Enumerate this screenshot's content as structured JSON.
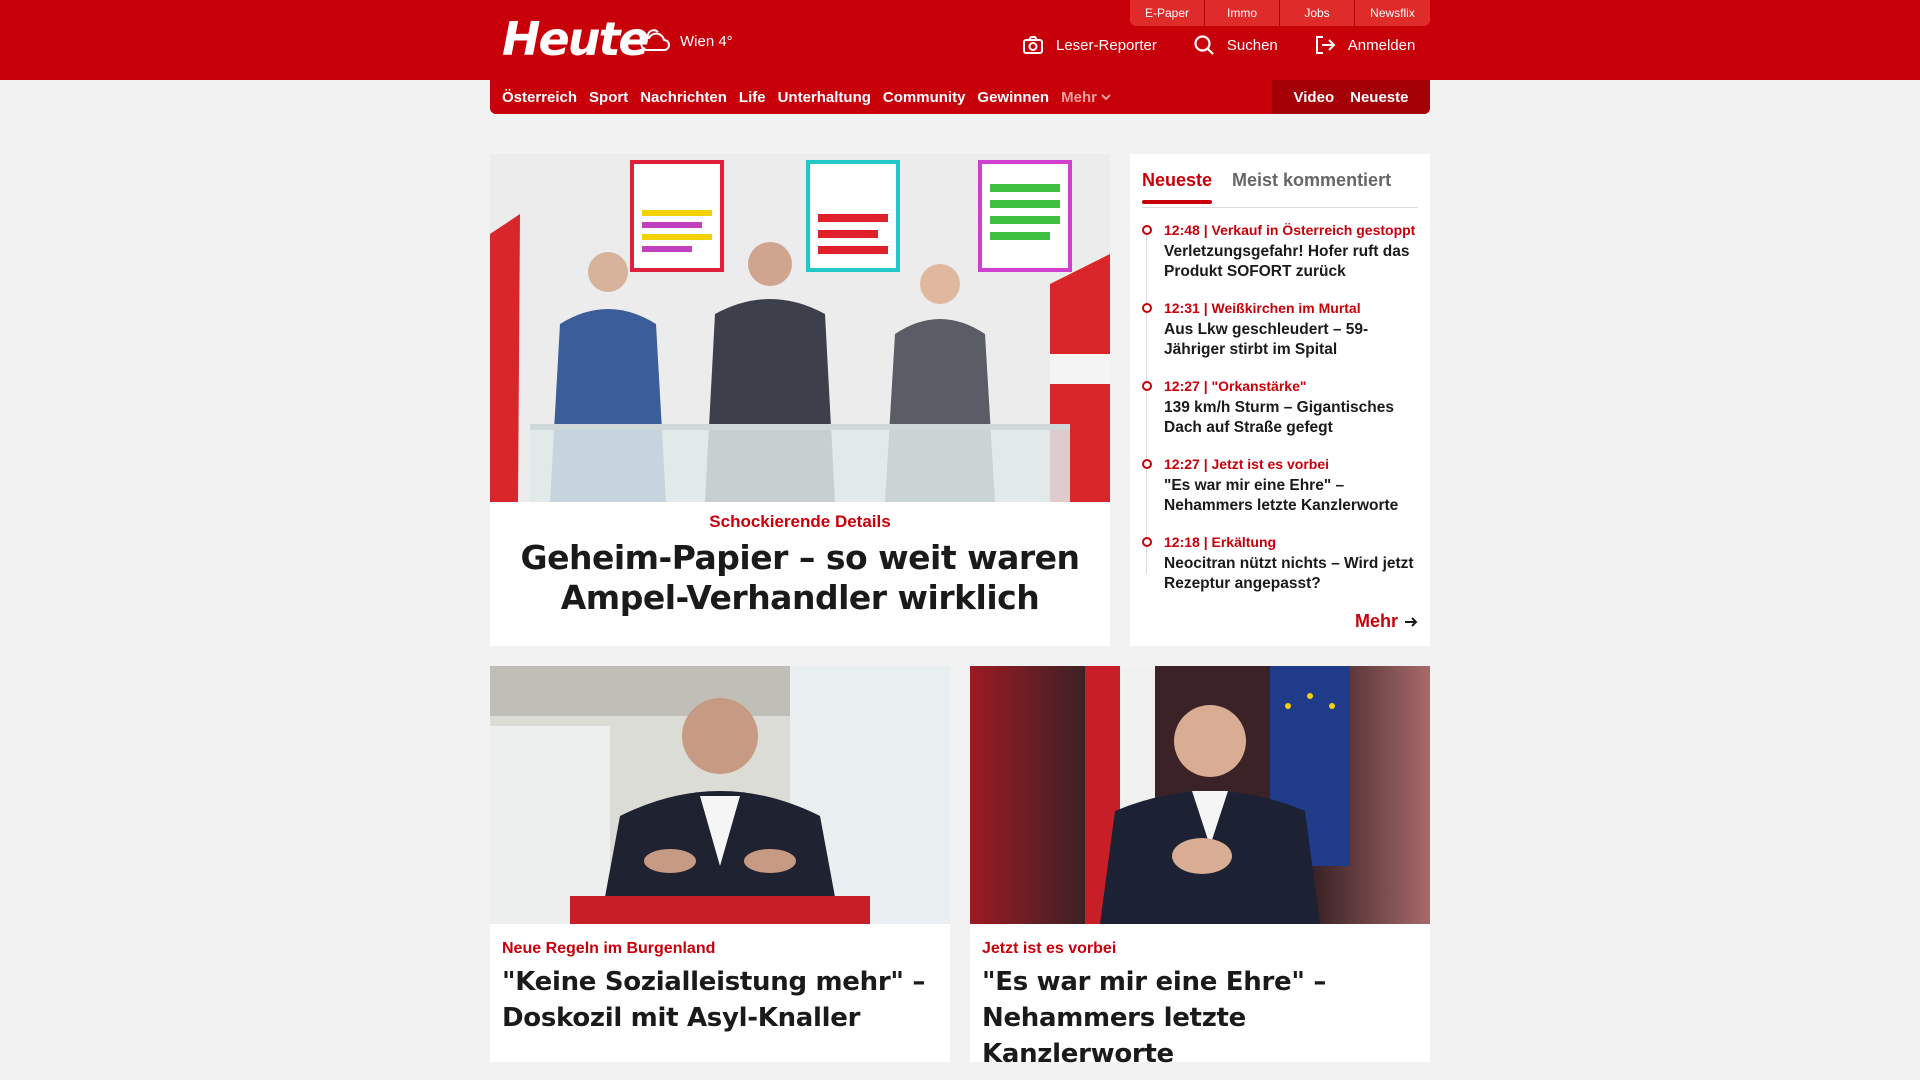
{
  "header": {
    "logo": "Heute",
    "weather": "Wien 4°",
    "service_tabs": [
      "E-Paper",
      "Immo",
      "Jobs",
      "Newsflix"
    ],
    "actions": [
      "Leser-Reporter",
      "Suchen",
      "Anmelden"
    ]
  },
  "nav": {
    "items": [
      "Österreich",
      "Sport",
      "Nachrichten",
      "Life",
      "Unterhaltung",
      "Community",
      "Gewinnen"
    ],
    "more": "Mehr",
    "right": [
      "Video",
      "Neueste"
    ]
  },
  "lead": {
    "kicker": "Schockierende Details",
    "headline": "Geheim-Papier – so weit waren Ampel-Verhandler wirklich"
  },
  "sidebar": {
    "tabs": [
      "Neueste",
      "Meist kommentiert"
    ],
    "items": [
      {
        "meta": "12:48 | Verkauf in Österreich gestoppt",
        "title": "Verletzungsgefahr! Hofer ruft das Produkt SOFORT zurück"
      },
      {
        "meta": "12:31 | Weißkirchen im Murtal",
        "title": "Aus Lkw geschleudert – 59-Jähriger stirbt im Spital"
      },
      {
        "meta": "12:27 | \"Orkanstärke\"",
        "title": "139 km/h Sturm – Gigantisches Dach auf Straße gefegt"
      },
      {
        "meta": "12:27 | Jetzt ist es vorbei",
        "title": "\"Es war mir eine Ehre\" – Nehammers letzte Kanzlerworte"
      },
      {
        "meta": "12:18 | Erkältung",
        "title": "Neocitran nützt nichts – Wird jetzt Rezeptur angepasst?"
      }
    ],
    "more": "Mehr"
  },
  "cards": [
    {
      "kicker": "Neue Regeln im Burgenland",
      "headline": "\"Keine Sozialleistung mehr\" – Doskozil mit Asyl-Knaller"
    },
    {
      "kicker": "Jetzt ist es vorbei",
      "headline": "\"Es war mir eine Ehre\" – Nehammers letzte Kanzlerworte"
    }
  ],
  "colors": {
    "brand": "#c8000a",
    "background": "#f2f2f2"
  }
}
